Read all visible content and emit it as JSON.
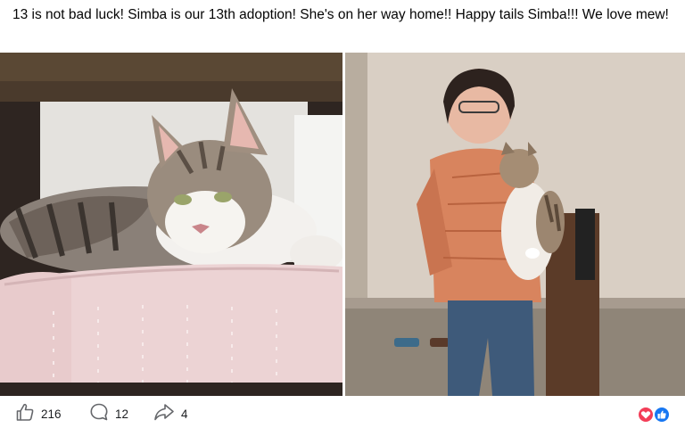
{
  "post": {
    "text": "13 is not bad luck! Simba is our 13th adoption! She's on her way home!! Happy tails Simba!!! We love mew!"
  },
  "actions": {
    "like_count": "216",
    "comment_count": "12",
    "share_count": "4"
  },
  "icons": {
    "like": "thumbs-up-icon",
    "comment": "comment-bubble-icon",
    "share": "share-arrow-icon",
    "reaction_love": "love-heart-reaction-icon",
    "reaction_like": "like-reaction-icon"
  },
  "colors": {
    "love": "#f33e58",
    "like": "#1877f2",
    "icon_gray": "#65676b"
  }
}
